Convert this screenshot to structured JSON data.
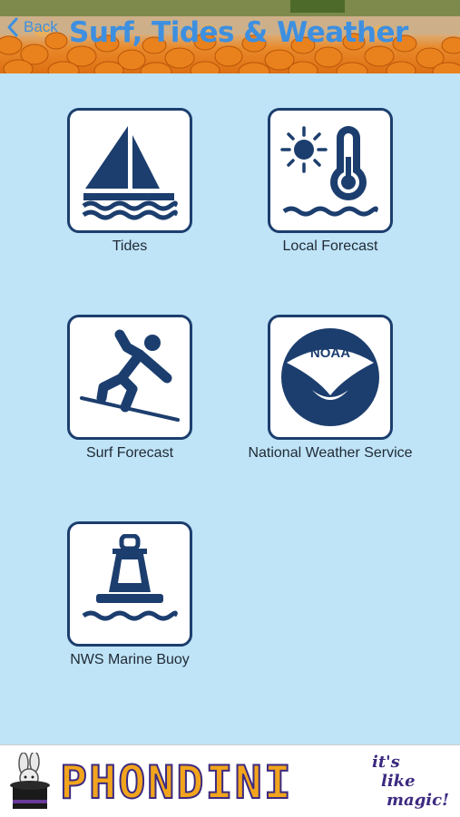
{
  "header": {
    "back_label": "Back",
    "title": "Surf, Tides & Weather"
  },
  "tiles": [
    {
      "label": "Tides",
      "icon": "sailboat-icon"
    },
    {
      "label": "Local Forecast",
      "icon": "sun-thermometer-icon"
    },
    {
      "label": "Surf Forecast",
      "icon": "surfer-icon"
    },
    {
      "label": "National Weather Service",
      "icon": "noaa-logo-icon"
    },
    {
      "label": "NWS Marine Buoy",
      "icon": "buoy-icon"
    }
  ],
  "footer": {
    "brand": "PHONDINI",
    "tagline_1": "it's",
    "tagline_2": "like",
    "tagline_3": "magic!",
    "logo_text": "NOAA"
  },
  "colors": {
    "background": "#bfe3f7",
    "icon_navy": "#1c3e6e",
    "title_blue": "#3d8fe0",
    "brand_orange": "#f2a51c",
    "brand_purple": "#3d2a80"
  }
}
